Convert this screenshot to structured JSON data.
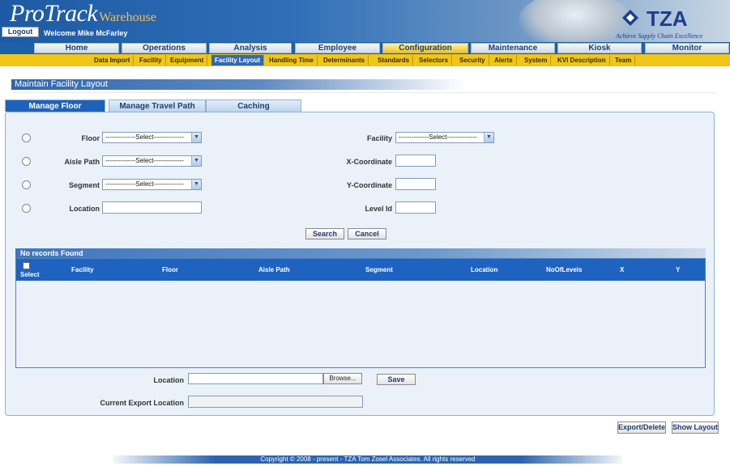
{
  "app": {
    "brand_main": "ProTrack",
    "brand_sub": "Warehouse",
    "logo_text": "TZA",
    "logo_tagline": "Achieve Supply Chain Excellence",
    "logout_label": "Logout",
    "welcome": "Welcome Mike McFarley"
  },
  "nav": {
    "main": [
      "Home",
      "Operations",
      "Analysis",
      "Employee",
      "Configuration",
      "Maintenance",
      "Kiosk",
      "Monitor"
    ],
    "active_main": "Configuration",
    "sub": [
      "Data Import",
      "Facility",
      "Equipment",
      "Facility Layout",
      "Handling Time",
      "Determinants",
      "Standards",
      "Selectors",
      "Security",
      "Alerts",
      "System",
      "KVI Description",
      "Team"
    ],
    "active_sub": "Facility Layout"
  },
  "page": {
    "title": "Maintain Facility Layout",
    "tabs": [
      "Manage Floor",
      "Manage Travel Path",
      "Caching"
    ],
    "active_tab": "Manage Floor"
  },
  "form": {
    "floor_label": "Floor",
    "floor_value": "--------------Select--------------",
    "aisle_label": "Aisle Path",
    "aisle_value": "--------------Select--------------",
    "segment_label": "Segment",
    "segment_value": "--------------Select--------------",
    "location_label": "Location",
    "facility_label": "Facility",
    "facility_value": "--------------Select--------------",
    "x_label": "X-Coordinate",
    "y_label": "Y-Coordinate",
    "level_label": "Level Id",
    "search_label": "Search",
    "cancel_label": "Cancel"
  },
  "grid": {
    "caption": "No records Found",
    "columns": [
      "Select",
      "Facility",
      "Floor",
      "Aisle Path",
      "Segment",
      "Location",
      "NoOfLevels",
      "X",
      "Y"
    ],
    "rows": []
  },
  "export": {
    "location_label": "Location",
    "browse_label": "Browse...",
    "save_label": "Save",
    "current_label": "Current Export Location"
  },
  "actions": {
    "export_delete": "Export/Delete",
    "show_layout": "Show Layout"
  },
  "footer": "Copyright © 2008 - present - TZA Tom Zosel Associates. All rights reserved"
}
